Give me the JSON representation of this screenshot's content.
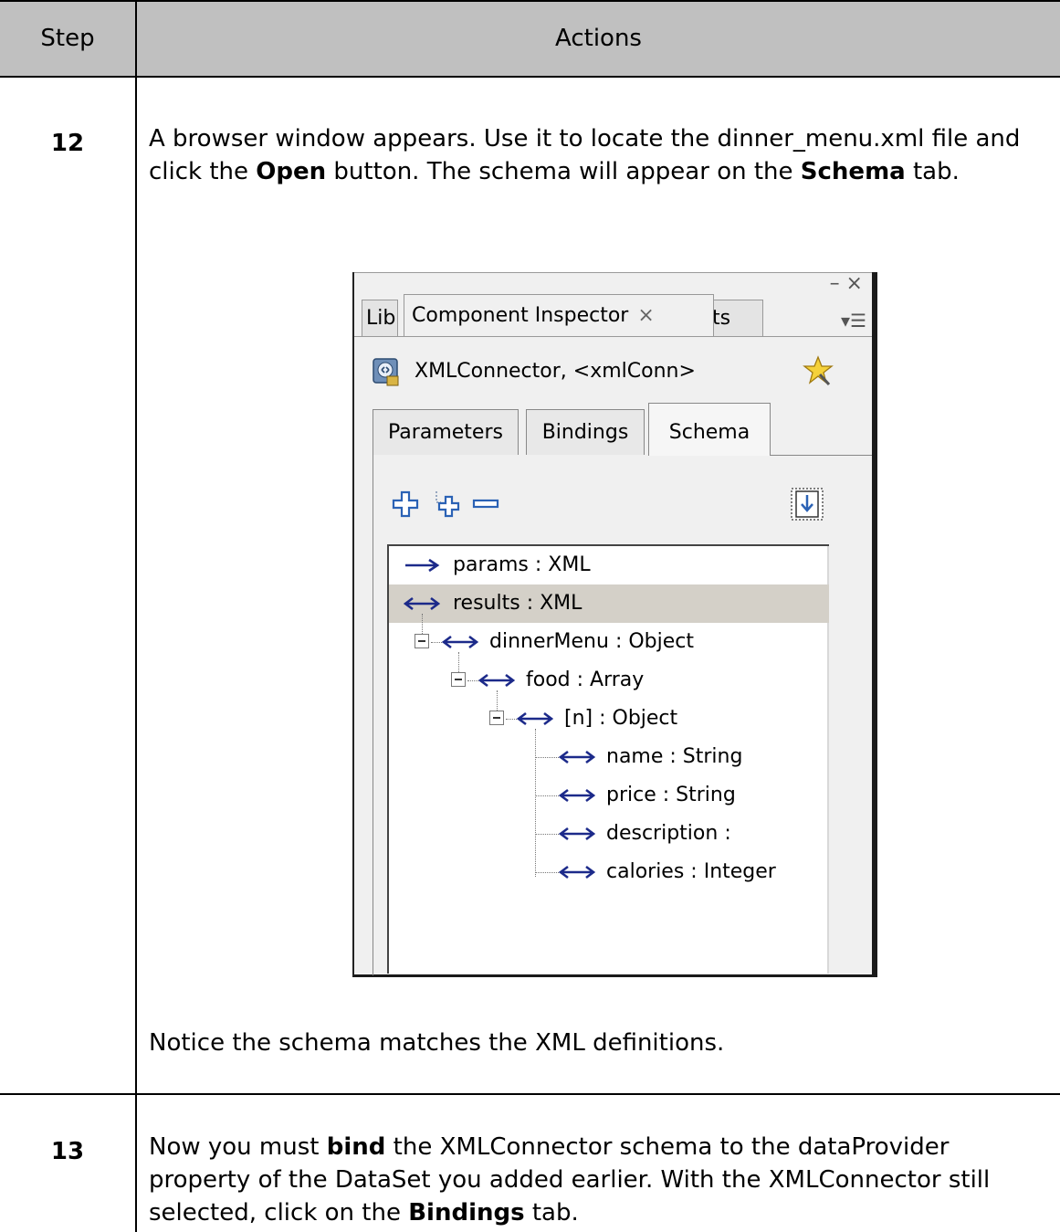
{
  "table": {
    "header": {
      "step": "Step",
      "actions": "Actions"
    },
    "rows": [
      {
        "step": "12",
        "text": [
          {
            "t": "A browser window appears. Use it to locate the dinner_menu.xml file and click the "
          },
          {
            "t": "Open",
            "b": true
          },
          {
            "t": " button. The schema will appear on the "
          },
          {
            "t": "Schema",
            "b": true
          },
          {
            "t": " tab."
          }
        ],
        "note": "Notice the schema matches the XML definitions."
      },
      {
        "step": "13",
        "text": [
          {
            "t": "Now you must "
          },
          {
            "t": "bind",
            "b": true
          },
          {
            "t": " the XMLConnector schema to the dataProvider property of the DataSet you added earlier. With the XMLConnector still selected, click on the "
          },
          {
            "t": "Bindings",
            "b": true
          },
          {
            "t": " tab."
          }
        ]
      }
    ]
  },
  "panel": {
    "window_controls": "– ×",
    "tabs": {
      "library": "Lib",
      "inspector": "Component Inspector",
      "inspector_close": "×",
      "other": "ts"
    },
    "menu": "▾☰",
    "component_name": "XMLConnector, <xmlConn>",
    "subtabs": [
      "Parameters",
      "Bindings",
      "Schema"
    ],
    "active_subtab": "Schema",
    "tree": [
      {
        "label": "params : XML",
        "dir": "in",
        "depth": 0
      },
      {
        "label": "results : XML",
        "dir": "both",
        "depth": 0,
        "selected": true
      },
      {
        "label": "dinnerMenu : Object",
        "dir": "both",
        "depth": 1,
        "expander": true
      },
      {
        "label": "food : Array",
        "dir": "both",
        "depth": 2,
        "expander": true
      },
      {
        "label": "[n] : Object",
        "dir": "both",
        "depth": 3,
        "expander": true
      },
      {
        "label": "name : String",
        "dir": "both",
        "depth": 4
      },
      {
        "label": "price : String",
        "dir": "both",
        "depth": 4
      },
      {
        "label": "description :",
        "dir": "both",
        "depth": 4
      },
      {
        "label": "calories : Integer",
        "dir": "both",
        "depth": 4
      }
    ]
  }
}
